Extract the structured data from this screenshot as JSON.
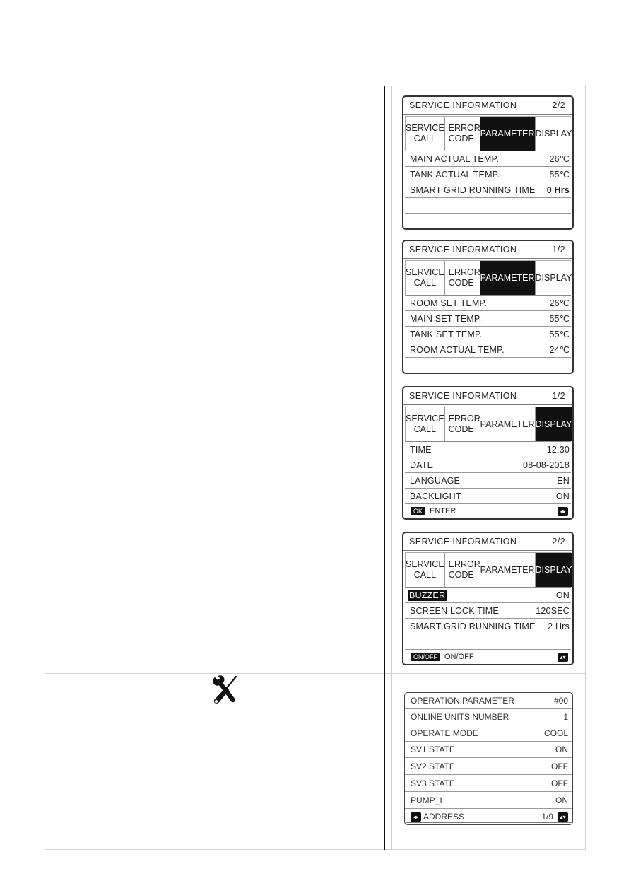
{
  "screens": [
    {
      "title": "SERVICE  INFORMATION",
      "page": "2/2",
      "tabs": [
        {
          "label": "SERVICE\nCALL",
          "active": false
        },
        {
          "label": "ERROR\nCODE",
          "active": false
        },
        {
          "label": "PARAMETER",
          "active": true
        },
        {
          "label": "DISPLAY",
          "active": false
        }
      ],
      "rows": [
        {
          "label": "MAIN  ACTUAL  TEMP.",
          "value": "26℃"
        },
        {
          "label": "TANK  ACTUAL  TEMP.",
          "value": "55℃"
        },
        {
          "label": "SMART GRID RUNNING TIME",
          "value": "0 Hrs"
        }
      ]
    },
    {
      "title": "SERVICE  INFORMATION",
      "page": "1/2",
      "tabs": [
        {
          "label": "SERVICE\nCALL",
          "active": false
        },
        {
          "label": "ERROR\nCODE",
          "active": false
        },
        {
          "label": "PARAMETER",
          "active": true
        },
        {
          "label": "DISPLAY",
          "active": false
        }
      ],
      "rows": [
        {
          "label": "ROOM  SET  TEMP.",
          "value": "26℃"
        },
        {
          "label": "MAIN  SET  TEMP.",
          "value": "55℃"
        },
        {
          "label": "TANK  SET  TEMP.",
          "value": "55℃"
        },
        {
          "label": "ROOM  ACTUAL  TEMP.",
          "value": "24℃"
        }
      ]
    },
    {
      "title": "SERVICE  INFORMATION",
      "page": "1/2",
      "tabs": [
        {
          "label": "SERVICE\nCALL",
          "active": false
        },
        {
          "label": "ERROR\nCODE",
          "active": false
        },
        {
          "label": "PARAMETER",
          "active": false
        },
        {
          "label": "DISPLAY",
          "active": true
        }
      ],
      "rows": [
        {
          "label": "TIME",
          "value": "12:30"
        },
        {
          "label": "DATE",
          "value": "08-08-2018"
        },
        {
          "label": "LANGUAGE",
          "value": "EN"
        },
        {
          "label": "BACKLIGHT",
          "value": "ON"
        }
      ],
      "footer": {
        "key": "OK",
        "text": "ENTER",
        "nav_icon": "◂▸"
      }
    },
    {
      "title": "SERVICE  INFORMATION",
      "page": "2/2",
      "tabs": [
        {
          "label": "SERVICE\nCALL",
          "active": false
        },
        {
          "label": "ERROR\nCODE",
          "active": false
        },
        {
          "label": "PARAMETER",
          "active": false
        },
        {
          "label": "DISPLAY",
          "active": true
        }
      ],
      "rows": [
        {
          "label": "BUZZER",
          "value": "ON",
          "highlighted": true
        },
        {
          "label": "SCREEN LOCK TIME",
          "value": "120SEC"
        },
        {
          "label": "SMART GRID RUNNING TIME",
          "value": "2 Hrs"
        }
      ],
      "footer": {
        "key": "ON/OFF",
        "text": "ON/OFF",
        "nav_icon": "▴▾"
      }
    }
  ],
  "operation_parameter": {
    "title": "OPERATION PARAMETER",
    "code": "#00",
    "rows": [
      {
        "label": "ONLINE UNITS NUMBER",
        "value": "1"
      },
      {
        "label": "OPERATE MODE",
        "value": "COOL"
      },
      {
        "label": "SV1 STATE",
        "value": "ON"
      },
      {
        "label": "SV2 STATE",
        "value": "OFF"
      },
      {
        "label": "SV3 STATE",
        "value": "OFF"
      },
      {
        "label": "PUMP_I",
        "value": "ON"
      }
    ],
    "footer": {
      "left_icon": "◂▸",
      "label": "ADDRESS",
      "page": "1/9",
      "right_icon": "▴▾"
    }
  },
  "icons": {
    "tools": "wrench-screwdriver-icon"
  }
}
